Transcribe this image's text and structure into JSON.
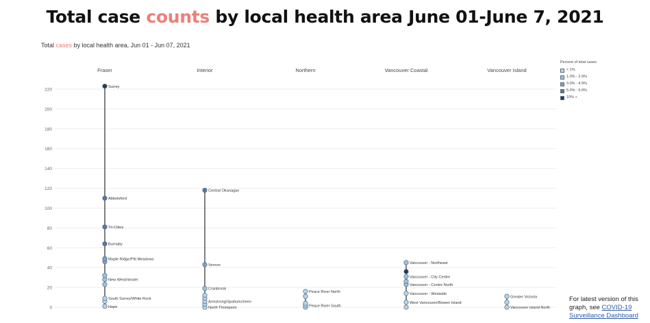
{
  "header": {
    "title_pre": "Total case ",
    "title_accent": "counts",
    "title_post": " by local health area June 01-June 7, 2021",
    "subtitle_pre": "Total ",
    "subtitle_accent": "cases",
    "subtitle_post": " by local health area, Jun 01 - Jun 07, 2021"
  },
  "colors": {
    "accent": "#ef7e78",
    "bin_lt1": "#b9d5e8",
    "bin_1_2": "#9ec3dd",
    "bin_3_4": "#7ea4c6",
    "bin_5_9": "#547aa0",
    "bin_10plus": "#243b55",
    "stem": "#2b2b2b",
    "grid": "#ececec"
  },
  "legend": {
    "title": "Percent of total cases",
    "items": [
      {
        "label": "< 1%",
        "color": "#b9d5e8"
      },
      {
        "label": "1.0% - 2.9%",
        "color": "#9ec3dd"
      },
      {
        "label": "3.0% - 4.9%",
        "color": "#7ea4c6"
      },
      {
        "label": "5.0% - 9.9%",
        "color": "#547aa0"
      },
      {
        "label": "10% +",
        "color": "#243b55"
      }
    ]
  },
  "note": {
    "line1": "For latest version of this",
    "line2_pre": "graph, see ",
    "link1": "COVID-19",
    "link2": "Surveillance Dashboard"
  },
  "chart_data": {
    "type": "scatter",
    "title": "Total cases by local health area, Jun 01 - Jun 07, 2021",
    "ylim": [
      0,
      230
    ],
    "yticks": [
      0,
      20,
      40,
      60,
      80,
      100,
      120,
      140,
      160,
      180,
      200,
      220
    ],
    "grid": true,
    "legend_position": "top-right",
    "panels": [
      {
        "name": "Fraser",
        "points": [
          {
            "label": "Surrey",
            "value": 223,
            "bin": "10plus"
          },
          {
            "label": "Abbotsford",
            "value": 110,
            "bin": "5_9"
          },
          {
            "label": "Tri-Cities",
            "value": 81,
            "bin": "5_9"
          },
          {
            "label": "Burnaby",
            "value": 64,
            "bin": "5_9"
          },
          {
            "label": "Maple Ridge/Pitt Meadows",
            "value": 49,
            "bin": "3_4"
          },
          {
            "label": "",
            "value": 46,
            "bin": "3_4"
          },
          {
            "label": "",
            "value": 32,
            "bin": "1_2"
          },
          {
            "label": "New Westminster",
            "value": 28,
            "bin": "1_2"
          },
          {
            "label": "",
            "value": 23,
            "bin": "1_2"
          },
          {
            "label": "South Surrey/White Rock",
            "value": 9,
            "bin": "lt1"
          },
          {
            "label": "",
            "value": 6,
            "bin": "lt1"
          },
          {
            "label": "Hope",
            "value": 1,
            "bin": "lt1"
          }
        ]
      },
      {
        "name": "Interior",
        "points": [
          {
            "label": "Central Okanagan",
            "value": 118,
            "bin": "5_9"
          },
          {
            "label": "Vernon",
            "value": 43,
            "bin": "3_4"
          },
          {
            "label": "Cranbrook",
            "value": 19,
            "bin": "1_2"
          },
          {
            "label": "",
            "value": 12,
            "bin": "lt1"
          },
          {
            "label": "",
            "value": 9,
            "bin": "lt1"
          },
          {
            "label": "Armstrong/Spallumcheen",
            "value": 6,
            "bin": "lt1"
          },
          {
            "label": "",
            "value": 3,
            "bin": "lt1"
          },
          {
            "label": "North Thompson",
            "value": 0,
            "bin": "lt1"
          }
        ]
      },
      {
        "name": "Northern",
        "points": [
          {
            "label": "Peace River North",
            "value": 16,
            "bin": "lt1"
          },
          {
            "label": "",
            "value": 11,
            "bin": "lt1"
          },
          {
            "label": "",
            "value": 4,
            "bin": "lt1"
          },
          {
            "label": "Peace River South",
            "value": 2,
            "bin": "lt1"
          },
          {
            "label": "",
            "value": 0,
            "bin": "lt1"
          }
        ]
      },
      {
        "name": "Vancouver Coastal",
        "points": [
          {
            "label": "Vancouver - Northeast",
            "value": 45,
            "bin": "1_2"
          },
          {
            "label": "",
            "value": 36,
            "bin": "10plus"
          },
          {
            "label": "Vancouver - City Centre",
            "value": 31,
            "bin": "1_2"
          },
          {
            "label": "",
            "value": 26,
            "bin": "1_2"
          },
          {
            "label": "Vancouver - Centre North",
            "value": 23,
            "bin": "1_2"
          },
          {
            "label": "Vancouver - Westside",
            "value": 14,
            "bin": "lt1"
          },
          {
            "label": "West Vancouver/Bowen Island",
            "value": 5,
            "bin": "lt1"
          },
          {
            "label": "",
            "value": 0,
            "bin": "lt1"
          }
        ]
      },
      {
        "name": "Vancouver Island",
        "points": [
          {
            "label": "Greater Victoria",
            "value": 11,
            "bin": "lt1"
          },
          {
            "label": "",
            "value": 5,
            "bin": "lt1"
          },
          {
            "label": "Vancouver Island North",
            "value": 0,
            "bin": "lt1"
          }
        ]
      }
    ]
  }
}
